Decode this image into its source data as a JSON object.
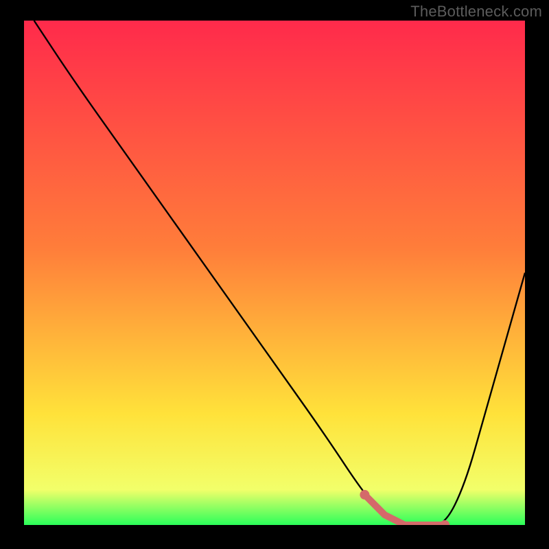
{
  "watermark": "TheBottleneck.com",
  "chart_data": {
    "type": "line",
    "title": "",
    "xlabel": "",
    "ylabel": "",
    "xlim": [
      0,
      100
    ],
    "ylim": [
      0,
      100
    ],
    "grid": false,
    "background_gradient": {
      "top": "#ff2a4b",
      "mid_upper": "#ff7d3a",
      "mid_lower": "#ffe23a",
      "bottom": "#2bff5a"
    },
    "series": [
      {
        "name": "bottleneck-curve",
        "x": [
          2,
          10,
          20,
          30,
          40,
          50,
          60,
          68,
          72,
          76,
          80,
          84,
          88,
          92,
          96,
          100
        ],
        "y": [
          100,
          88,
          74,
          60,
          46,
          32,
          18,
          6,
          2,
          0,
          0,
          0,
          8,
          22,
          36,
          50
        ]
      }
    ],
    "highlight": {
      "name": "optimal-band",
      "color": "#d46a6a",
      "x": [
        68,
        72,
        76,
        80,
        84
      ],
      "y": [
        6,
        2,
        0,
        0,
        0
      ]
    }
  }
}
